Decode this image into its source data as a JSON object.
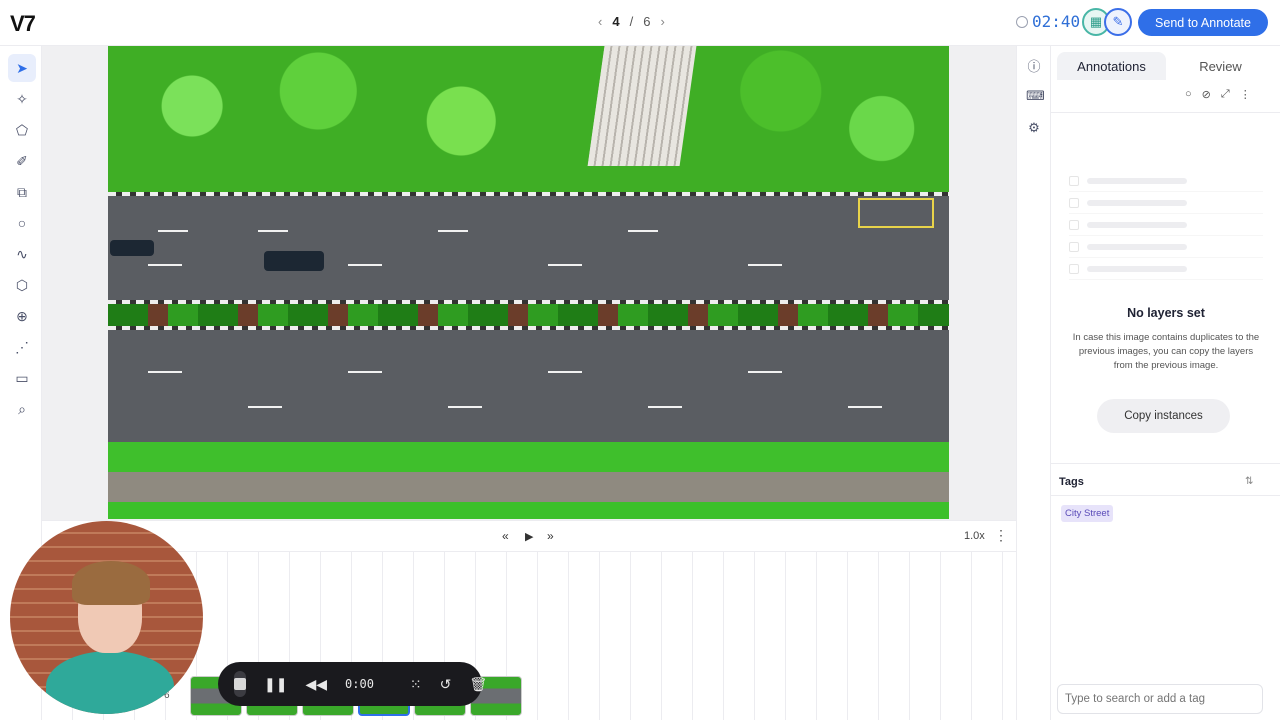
{
  "app": {
    "logo": "V7"
  },
  "pager": {
    "current": "4",
    "separator": "/",
    "total": "6",
    "prev_icon": "chevron-left",
    "next_icon": "chevron-right"
  },
  "header": {
    "timer": "02:40",
    "send_label": "Send to Annotate"
  },
  "toolbar": {
    "tools": [
      "cursor",
      "auto-annotate",
      "polygon",
      "brush",
      "bounding-box",
      "ellipse",
      "polyline",
      "cuboid",
      "keypoint",
      "skeleton",
      "comment",
      "zoom"
    ]
  },
  "player": {
    "rewind": "«",
    "play": "▶",
    "forward": "»",
    "speed": "1.0x"
  },
  "timeline": {
    "frame_count": "6"
  },
  "recorder": {
    "time": "0:00"
  },
  "right_panel": {
    "tabs": [
      {
        "label": "Annotations",
        "active": true
      },
      {
        "label": "Review",
        "active": false
      }
    ],
    "empty_title": "No layers set",
    "empty_desc": "In case this image contains duplicates to the previous images, you can copy the layers from the previous image.",
    "copy_label": "Copy instances",
    "tags_title": "Tags",
    "tags": [
      "City Street"
    ],
    "tag_placeholder": "Type to search or add a tag"
  },
  "colors": {
    "accent": "#2f6fe8",
    "tag_bg": "#e7e3fa",
    "tag_text": "#5a4bb8",
    "timer": "#2f6fd6"
  }
}
